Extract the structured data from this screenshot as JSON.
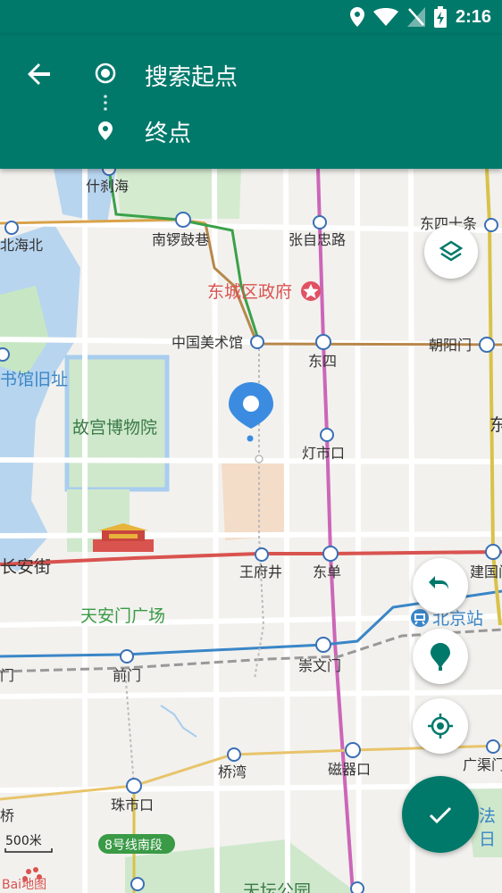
{
  "status": {
    "time": "2:16"
  },
  "header": {
    "start_label": "搜索起点",
    "end_label": "终点"
  },
  "map": {
    "labels": {
      "shichahai": "什刹海",
      "beihaibei": "北海北",
      "nanluoguxiang": "南锣鼓巷",
      "zhangzizhonglu": "张自忠路",
      "dongsishitiao": "东四十条",
      "dongcheng_gov": "东城区政府",
      "meishuguan": "中国美术馆",
      "dongsi": "东四",
      "chaoyangmen": "朝阳门",
      "library": "书馆旧址",
      "palace": "故宫博物院",
      "dengshikou": "灯市口",
      "dong_edge": "东",
      "changanjie": "长安街",
      "wangfujing": "王府井",
      "dongdan": "东单",
      "jianguomen": "建国门",
      "tiananmen_sq": "天安门广场",
      "beijing_station": "北京站",
      "qianmen_edge": "门",
      "qianmen": "前门",
      "chongwenmen": "崇文门",
      "qiaowan": "桥湾",
      "ciqikou": "磁器口",
      "guangqumen": "广渠门",
      "zhushikou": "珠市口",
      "qiao_edge": "桥",
      "line8": "8号线南段",
      "fa_edge": "法",
      "ri_edge": "日",
      "tiantan": "天坛公园",
      "scale": "500米",
      "logo": "Bai地图"
    }
  },
  "colors": {
    "primary": "#00796b",
    "line_orange": "#d9a34a",
    "line_red": "#d9534f",
    "line_green": "#3aa14a",
    "line_pink": "#cc66b8",
    "line_blue": "#3a86c7",
    "pin_blue": "#3b8ce0"
  }
}
